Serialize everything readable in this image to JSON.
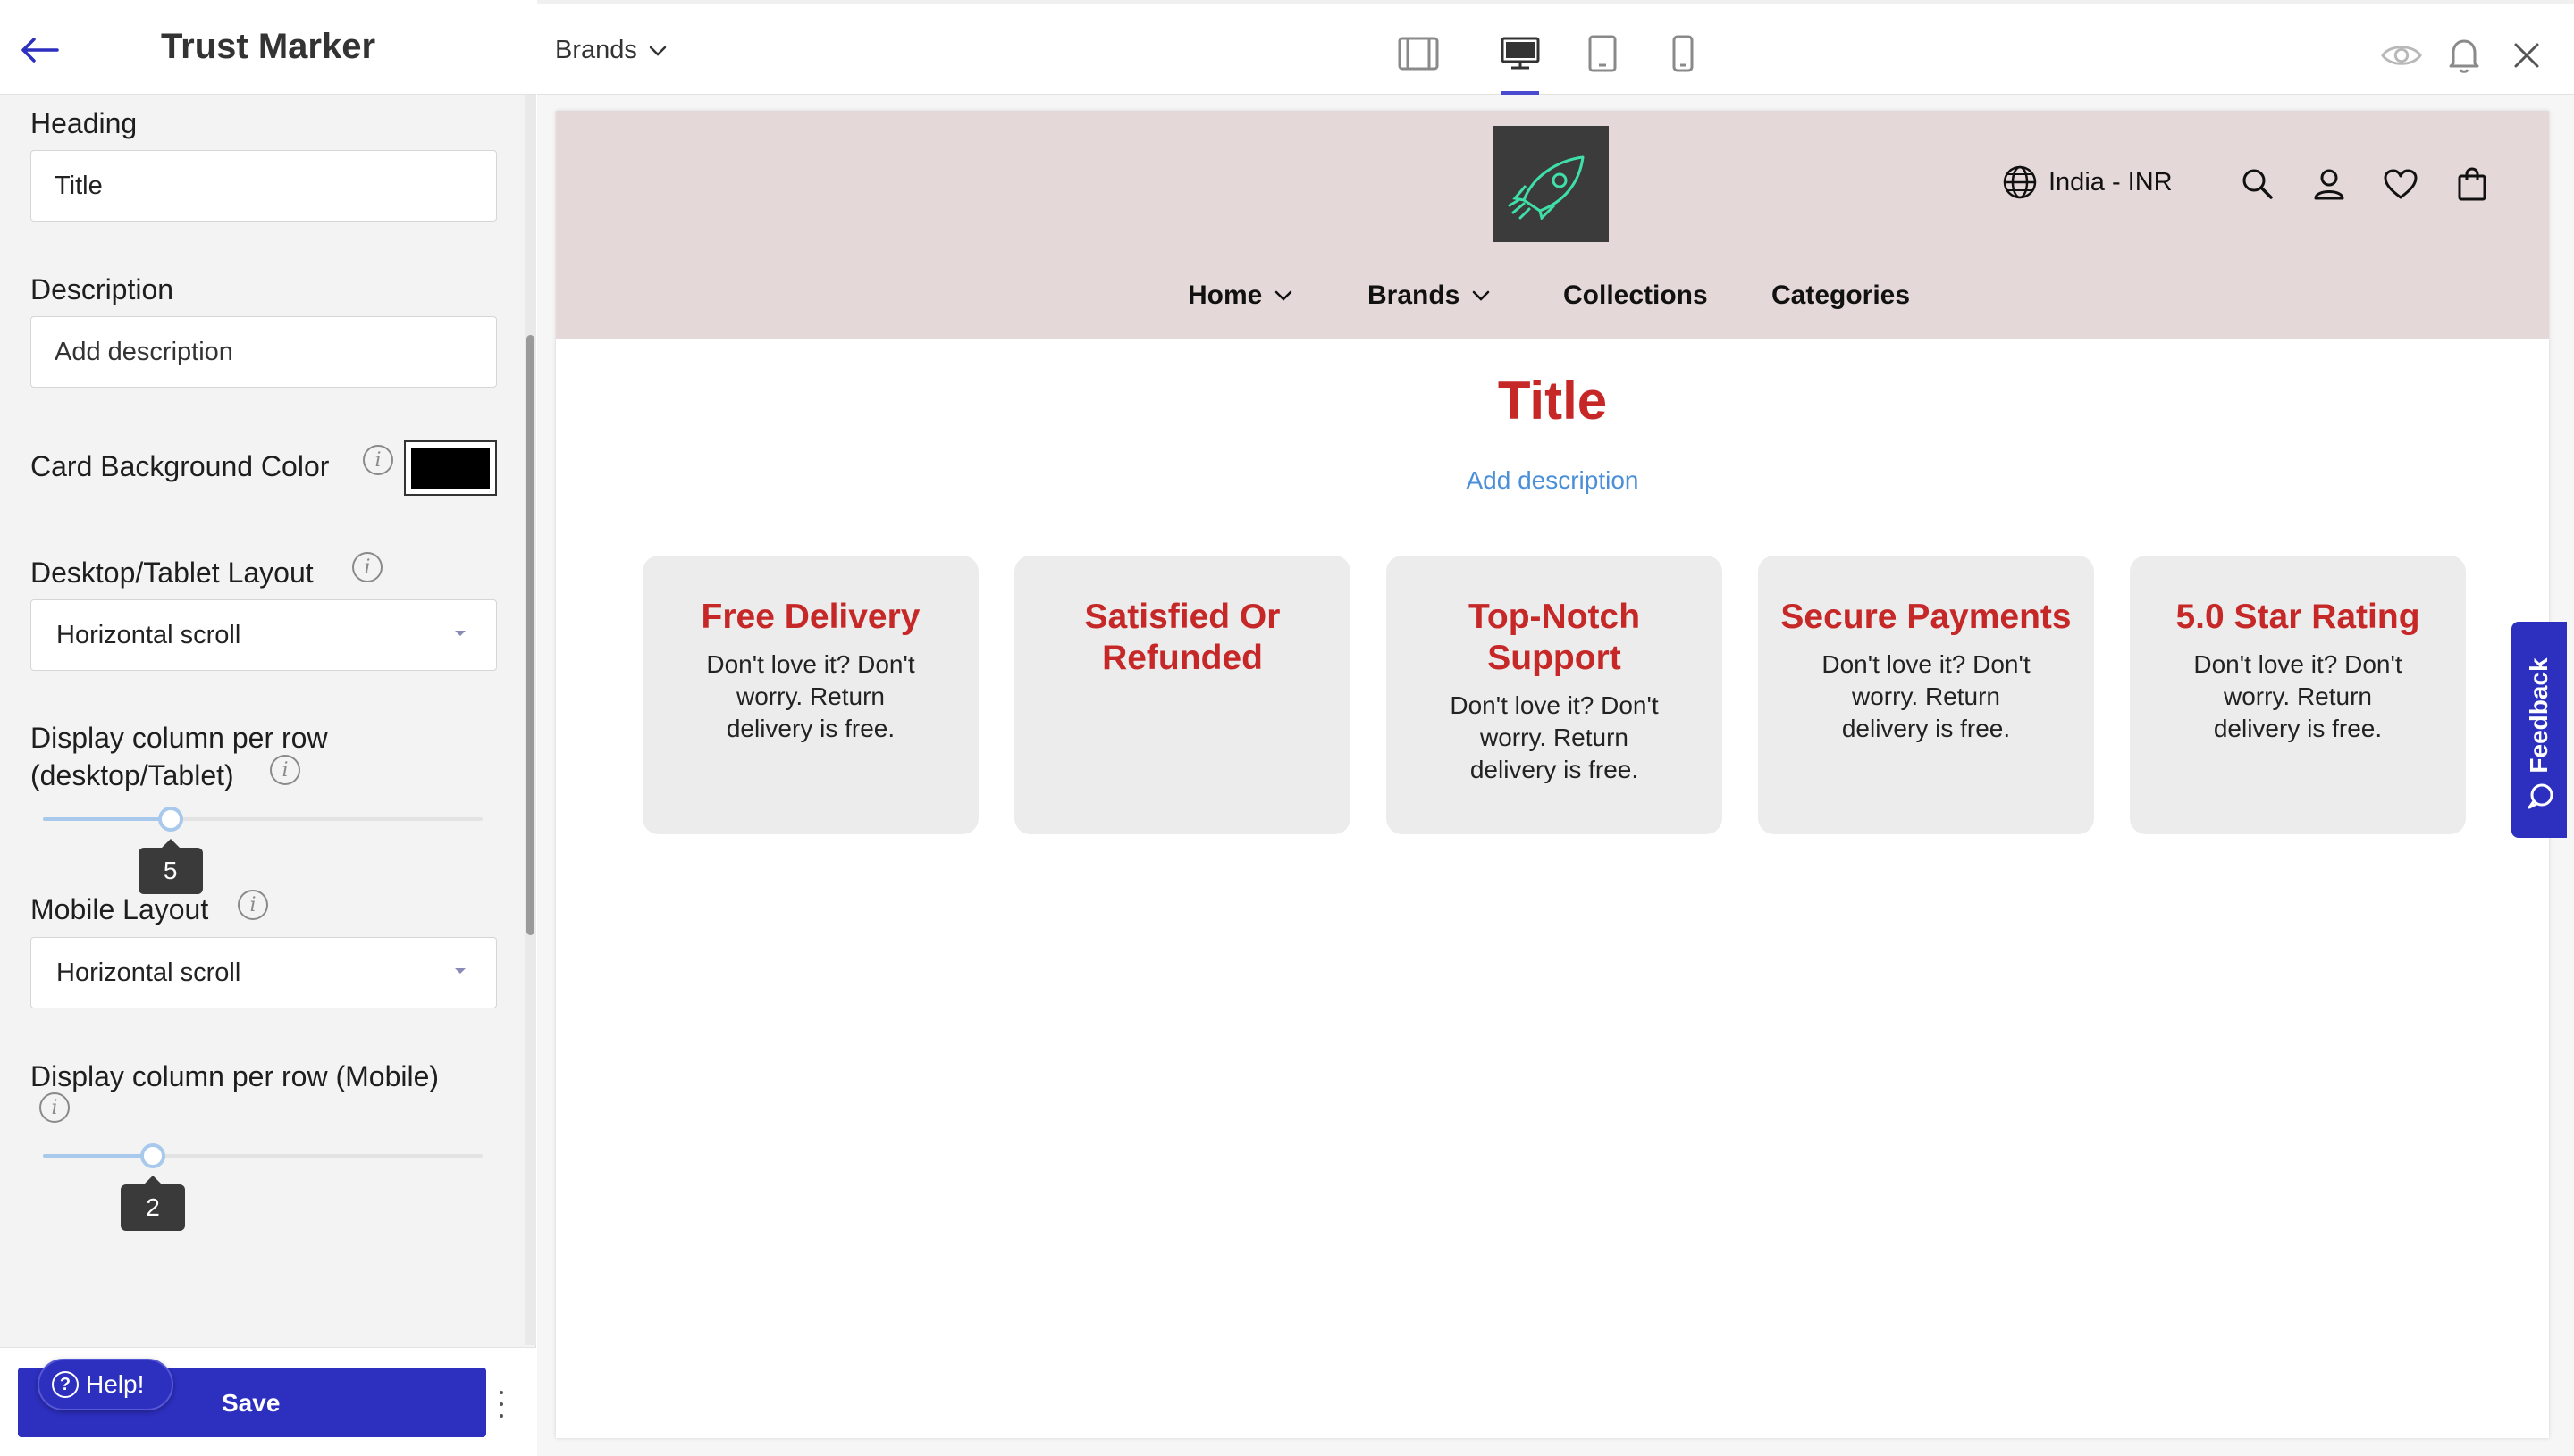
{
  "panel": {
    "title": "Trust Marker",
    "heading_label": "Heading",
    "heading_value": "Title",
    "description_label": "Description",
    "description_placeholder": "Add description",
    "card_bg_label": "Card Background Color",
    "card_bg_color": "#000000",
    "desktop_layout_label": "Desktop/Tablet Layout",
    "desktop_layout_value": "Horizontal scroll",
    "desktop_columns_label_line1": "Display column per row",
    "desktop_columns_label_line2": "(desktop/Tablet)",
    "desktop_columns_value": "5",
    "desktop_columns_fraction": 0.29,
    "mobile_layout_label": "Mobile Layout",
    "mobile_layout_value": "Horizontal scroll",
    "mobile_columns_label": "Display column per row (Mobile)",
    "mobile_columns_value": "2",
    "mobile_columns_fraction": 0.25,
    "save_label": "Save",
    "help_label": "Help!"
  },
  "toolbar": {
    "page_select": "Brands",
    "device_icons": [
      "sidebar-layout-icon",
      "desktop-icon",
      "tablet-icon",
      "mobile-icon"
    ],
    "active_device": "desktop-icon",
    "accent_color": "#4a4acf"
  },
  "site": {
    "header_bg": "#e5d8d8",
    "locale": "India - INR",
    "nav": [
      {
        "label": "Home",
        "has_dropdown": true
      },
      {
        "label": "Brands",
        "has_dropdown": true
      },
      {
        "label": "Collections",
        "has_dropdown": false
      },
      {
        "label": "Categories",
        "has_dropdown": false
      }
    ]
  },
  "section": {
    "title": "Title",
    "description": "Add description",
    "title_color": "#c62828",
    "description_color": "#4a8fd8",
    "cards": [
      {
        "title": "Free Delivery",
        "text": "Don't love it? Don't worry. Return delivery is free."
      },
      {
        "title": "Satisfied Or Refunded",
        "text": ""
      },
      {
        "title": "Top-Notch Support",
        "text": "Don't love it? Don't worry. Return delivery is free."
      },
      {
        "title": "Secure Payments",
        "text": "Don't love it? Don't worry. Return delivery is free."
      },
      {
        "title": "5.0 Star Rating",
        "text": "Don't love it? Don't worry. Return delivery is free."
      }
    ]
  },
  "feedback": {
    "label": "Feedback"
  },
  "brand_color": "#2d2fbf"
}
